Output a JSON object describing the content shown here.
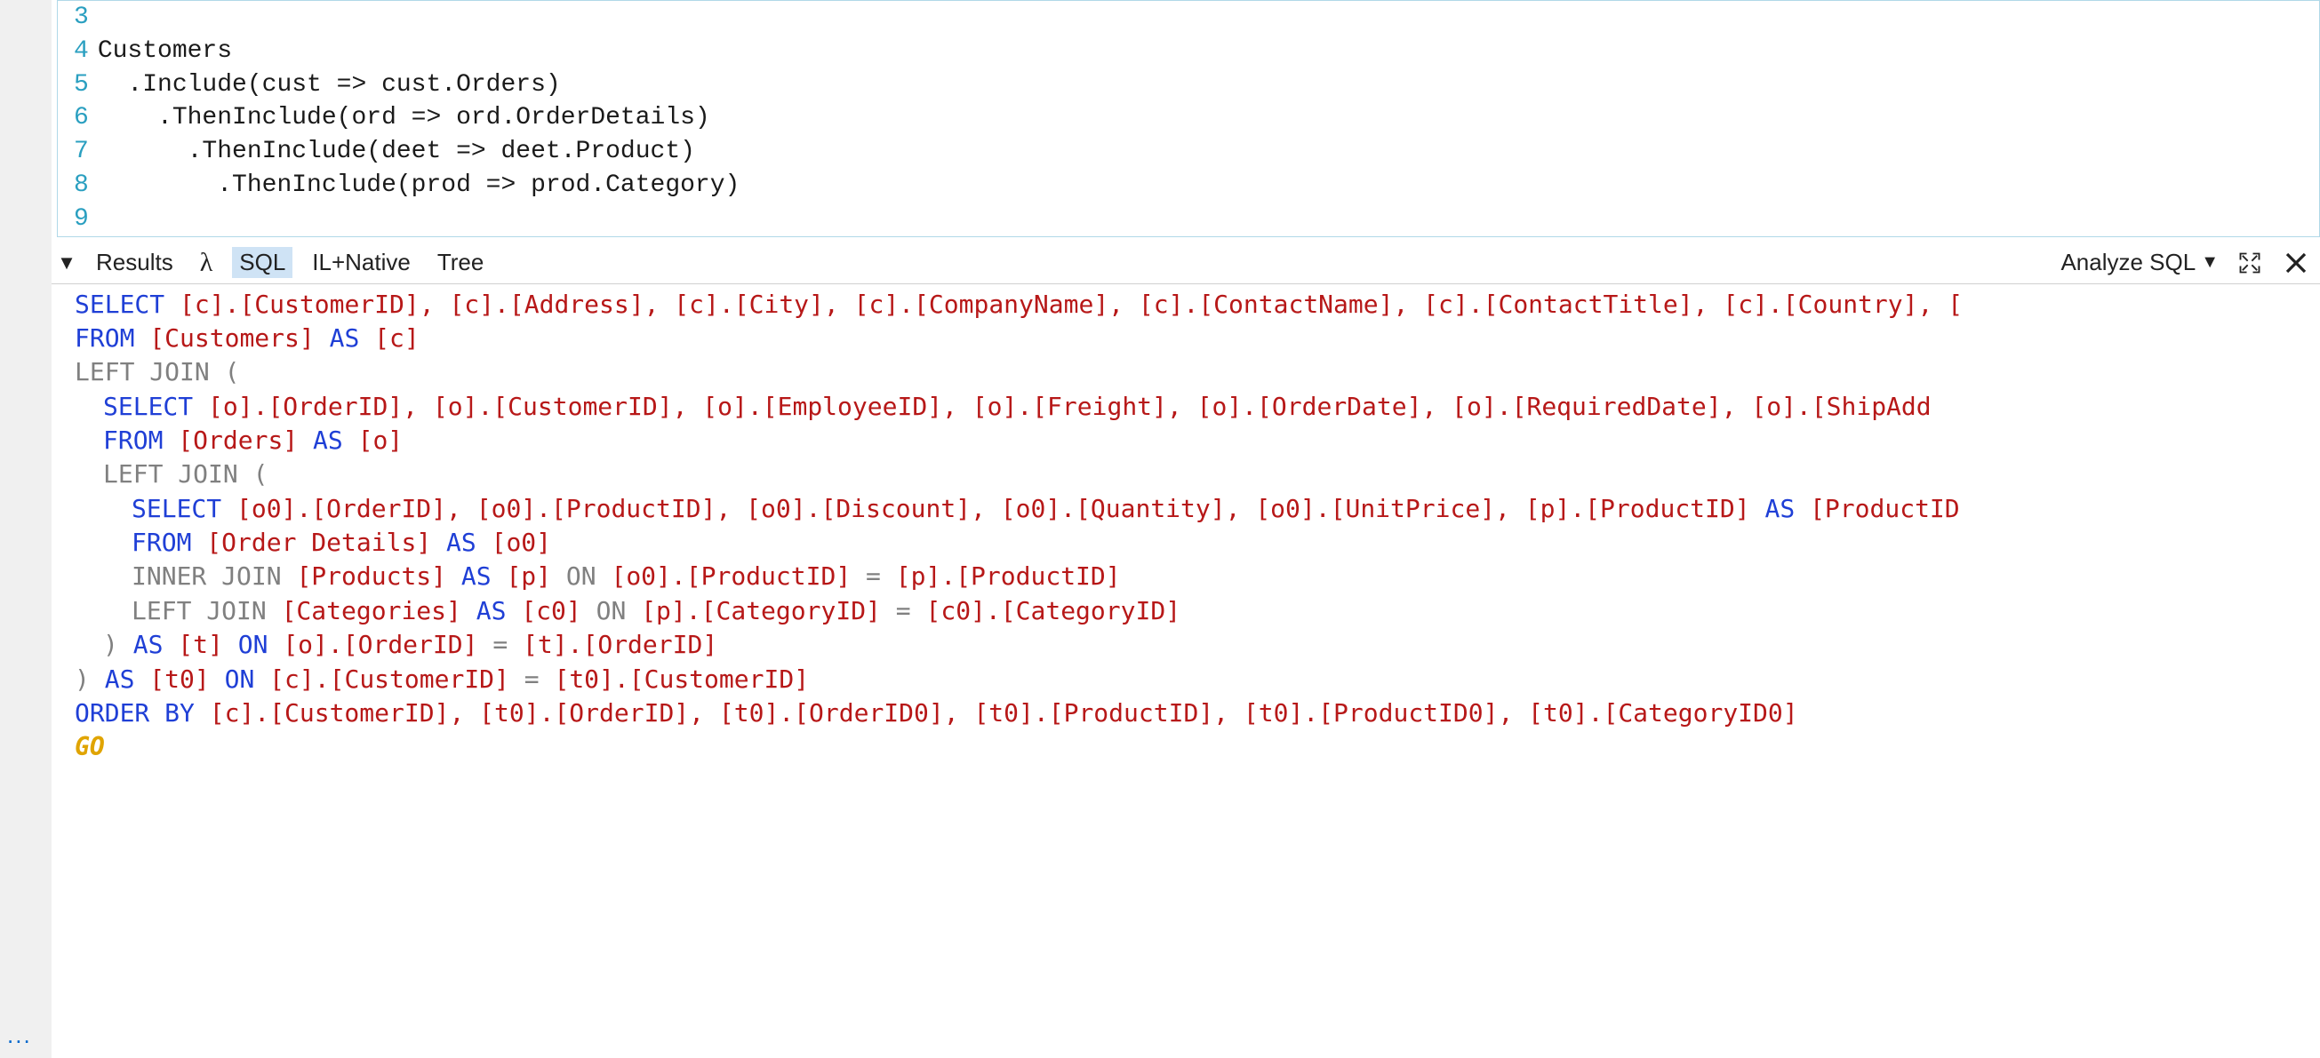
{
  "left_gutter": {
    "ellipsis": "..."
  },
  "editor": {
    "lines": [
      {
        "num": "3",
        "text": ""
      },
      {
        "num": "4",
        "text": "Customers"
      },
      {
        "num": "5",
        "text": "  .Include(cust => cust.Orders)"
      },
      {
        "num": "6",
        "text": "    .ThenInclude(ord => ord.OrderDetails)"
      },
      {
        "num": "7",
        "text": "      .ThenInclude(deet => deet.Product)"
      },
      {
        "num": "8",
        "text": "        .ThenInclude(prod => prod.Category)"
      },
      {
        "num": "9",
        "text": ""
      }
    ]
  },
  "tabs": {
    "results": "Results",
    "lambda": "λ",
    "sql": "SQL",
    "il_native": "IL+Native",
    "tree": "Tree",
    "analyze": "Analyze SQL"
  },
  "sql": {
    "l1": {
      "kw_select": "SELECT ",
      "cols": "[c].[CustomerID], [c].[Address], [c].[City], [c].[CompanyName], [c].[ContactName], [c].[ContactTitle], [c].[Country], ["
    },
    "l2": {
      "kw_from": "FROM ",
      "tbl": "[Customers] ",
      "kw_as": "AS ",
      "alias": "[c]"
    },
    "l3": {
      "kw": "LEFT JOIN ",
      "paren": "("
    },
    "l4": {
      "kw_select": "SELECT ",
      "cols": "[o].[OrderID], [o].[CustomerID], [o].[EmployeeID], [o].[Freight], [o].[OrderDate], [o].[RequiredDate], [o].[ShipAdd"
    },
    "l5": {
      "kw_from": "FROM ",
      "tbl": "[Orders] ",
      "kw_as": "AS ",
      "alias": "[o]"
    },
    "l6": {
      "kw": "LEFT JOIN ",
      "paren": "("
    },
    "l7": {
      "kw_select": "SELECT ",
      "cols1": "[o0].[OrderID], [o0].[ProductID], [o0].[Discount], [o0].[Quantity], [o0].[UnitPrice], [p].[ProductID] ",
      "kw_as": "AS ",
      "cols2": "[ProductID"
    },
    "l8": {
      "kw_from": "FROM ",
      "tbl": "[Order Details] ",
      "kw_as": "AS ",
      "alias": "[o0]"
    },
    "l9": {
      "kw_ij": "INNER JOIN ",
      "tbl": "[Products] ",
      "kw_as": "AS ",
      "alias": "[p] ",
      "kw_on": "ON ",
      "lhs": "[o0].[ProductID] ",
      "eq": "= ",
      "rhs": "[p].[ProductID]"
    },
    "l10": {
      "kw_lj": "LEFT JOIN ",
      "tbl": "[Categories] ",
      "kw_as": "AS ",
      "alias": "[c0] ",
      "kw_on": "ON ",
      "lhs": "[p].[CategoryID] ",
      "eq": "= ",
      "rhs": "[c0].[CategoryID]"
    },
    "l11": {
      "close": ") ",
      "kw_as": "AS ",
      "alias": "[t] ",
      "kw_on": "ON ",
      "lhs": "[o].[OrderID] ",
      "eq": "= ",
      "rhs": "[t].[OrderID]"
    },
    "l12": {
      "close": ") ",
      "kw_as": "AS ",
      "alias": "[t0] ",
      "kw_on": "ON ",
      "lhs": "[c].[CustomerID] ",
      "eq": "= ",
      "rhs": "[t0].[CustomerID]"
    },
    "l13": {
      "kw_ob": "ORDER BY ",
      "cols": "[c].[CustomerID], [t0].[OrderID], [t0].[OrderID0], [t0].[ProductID], [t0].[ProductID0], [t0].[CategoryID0]"
    },
    "l14": {
      "go": "GO"
    }
  }
}
